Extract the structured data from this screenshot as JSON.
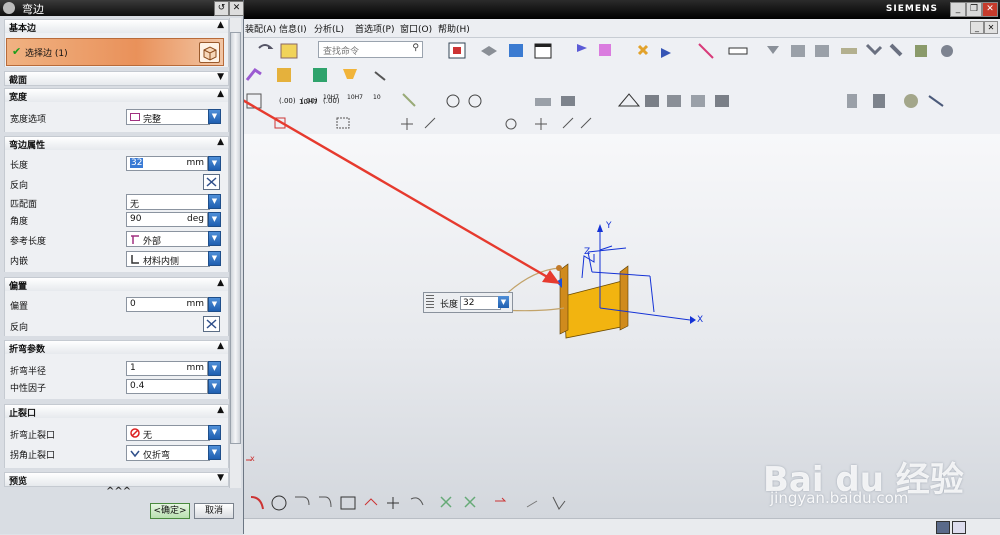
{
  "app": {
    "brand": "SIEMENS",
    "minimize": "_",
    "restore": "❐",
    "close": "✕"
  },
  "menu": [
    "装配(A)",
    "信息(I)",
    "分析(L)",
    "首选项(P)",
    "窗口(O)",
    "帮助(H)"
  ],
  "search": {
    "placeholder": "查找命令"
  },
  "toolbar_text": {
    "t1": "10H7",
    "t2": "10H7",
    "t3": "10H7",
    "t4": "10",
    "t5": "(.00)",
    "t6": "(.00)",
    "t7": "(.00)"
  },
  "dialog": {
    "title": "弯边",
    "sections": {
      "base_edge": "基本边",
      "profile": "截面",
      "width": "宽度",
      "flange_props": "弯边属性",
      "offset": "偏置",
      "bend_params": "折弯参数",
      "relief": "止裂口",
      "preview": "预览"
    },
    "select_edge": "选择边 (1)",
    "width_option_label": "宽度选项",
    "width_option_value": "完整",
    "length_label": "长度",
    "length_value": "32",
    "length_unit": "mm",
    "reverse_label": "反向",
    "match_face_label": "匹配面",
    "match_face_value": "无",
    "angle_label": "角度",
    "angle_value": "90",
    "angle_unit": "deg",
    "ref_length_label": "参考长度",
    "ref_length_value": "外部",
    "inset_label": "内嵌",
    "inset_value": "材料内侧",
    "offset_label": "偏置",
    "offset_value": "0",
    "offset_unit": "mm",
    "offset_reverse_label": "反向",
    "bend_radius_label": "折弯半径",
    "bend_radius_value": "1",
    "bend_radius_unit": "mm",
    "neutral_label": "中性因子",
    "neutral_value": "0.4",
    "bend_relief_label": "折弯止裂口",
    "bend_relief_value": "无",
    "corner_relief_label": "拐角止裂口",
    "corner_relief_value": "仅折弯",
    "more": "^^^",
    "ok": "<确定>",
    "cancel": "取消"
  },
  "viewport": {
    "axis_x": "X",
    "axis_y": "Y",
    "axis_z": "Z",
    "float_label": "长度",
    "float_value": "32",
    "small_x": "x"
  },
  "watermark": {
    "text": "Bai du 经验",
    "url": "jingyan.baidu.com"
  },
  "colors": {
    "accent": "#e9915a",
    "part": "#f2b410",
    "arrow": "#e63a2e",
    "axis": "#1432d6"
  }
}
